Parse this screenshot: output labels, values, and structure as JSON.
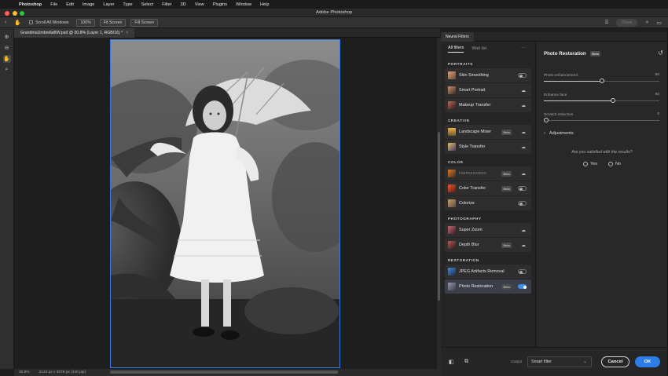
{
  "menubar": {
    "app_name": "Photoshop",
    "items": [
      "File",
      "Edit",
      "Image",
      "Layer",
      "Type",
      "Select",
      "Filter",
      "3D",
      "View",
      "Plugins",
      "Window",
      "Help"
    ]
  },
  "window": {
    "title": "Adobe Photoshop"
  },
  "options_bar": {
    "scroll_all_label": "Scroll All Windows",
    "zoom_btn": "100%",
    "fit_screen_btn": "Fit Screen",
    "fill_screen_btn": "Fill Screen",
    "share_btn": "Share"
  },
  "document": {
    "tab_label": "GrandmaUmbrellaBW.psd @ 30.8% (Layer 1, RGB/16) *",
    "close_glyph": "×"
  },
  "status_bar": {
    "zoom": "30.8%",
    "doc_info": "2143 px x 3078 px (240 ppi)"
  },
  "neural_filters": {
    "panel_title": "Neural Filters",
    "tabs": {
      "all": "All filters",
      "wait": "Wait list"
    },
    "more_glyph": "···",
    "categories": {
      "portraits": "PORTRAITS",
      "creative": "CREATIVE",
      "color": "COLOR",
      "photography": "PHOTOGRAPHY",
      "restoration": "RESTORATION"
    },
    "filters": {
      "skin_smoothing": "Skin Smoothing",
      "smart_portrait": "Smart Portrait",
      "makeup_transfer": "Makeup Transfer",
      "landscape_mixer": "Landscape Mixer",
      "style_transfer": "Style Transfer",
      "harmonization": "Harmonization",
      "color_transfer": "Color Transfer",
      "colorize": "Colorize",
      "super_zoom": "Super Zoom",
      "depth_blur": "Depth Blur",
      "jpeg_artifacts": "JPEG Artifacts Removal",
      "photo_restoration": "Photo Restoration"
    },
    "beta_badge": "Beta",
    "detail": {
      "title": "Photo Restoration",
      "sliders": {
        "photo_enhancement": {
          "label": "Photo enhancement",
          "value": "50"
        },
        "enhance_face": {
          "label": "Enhance face",
          "value": "60"
        },
        "scratch_reduction": {
          "label": "Scratch reduction",
          "value": "0"
        }
      },
      "adjustments": "Adjustments",
      "question": "Are you satisfied with the results?",
      "yes": "Yes",
      "no": "No"
    },
    "footer": {
      "output_label": "Output",
      "output_value": "Smart filter",
      "cancel": "Cancel",
      "ok": "OK"
    }
  },
  "colors": {
    "accent": "#2c7de7",
    "selection_border": "#3b78e7",
    "close": "#ff5f57",
    "minimize": "#febc2e",
    "maximize": "#28c840"
  }
}
